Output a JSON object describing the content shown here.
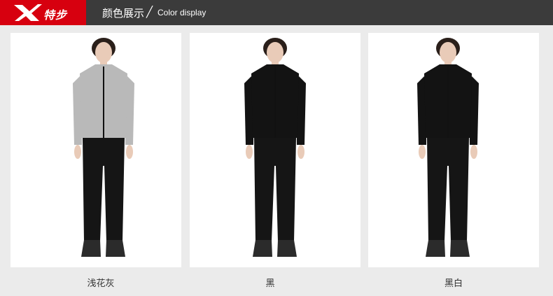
{
  "header": {
    "brand_text": "特步",
    "title_cn": "颜色展示",
    "title_sep": "╱",
    "title_en": "Color display"
  },
  "colors": {
    "brand_red": "#d7000f",
    "header_bg": "#3b3b3b",
    "page_bg": "#ebebeb"
  },
  "products": [
    {
      "label": "浅花灰",
      "jacket_color": "#b9b9b9"
    },
    {
      "label": "黑",
      "jacket_color": "#131313"
    },
    {
      "label": "黑白",
      "jacket_color": "#131313"
    }
  ]
}
